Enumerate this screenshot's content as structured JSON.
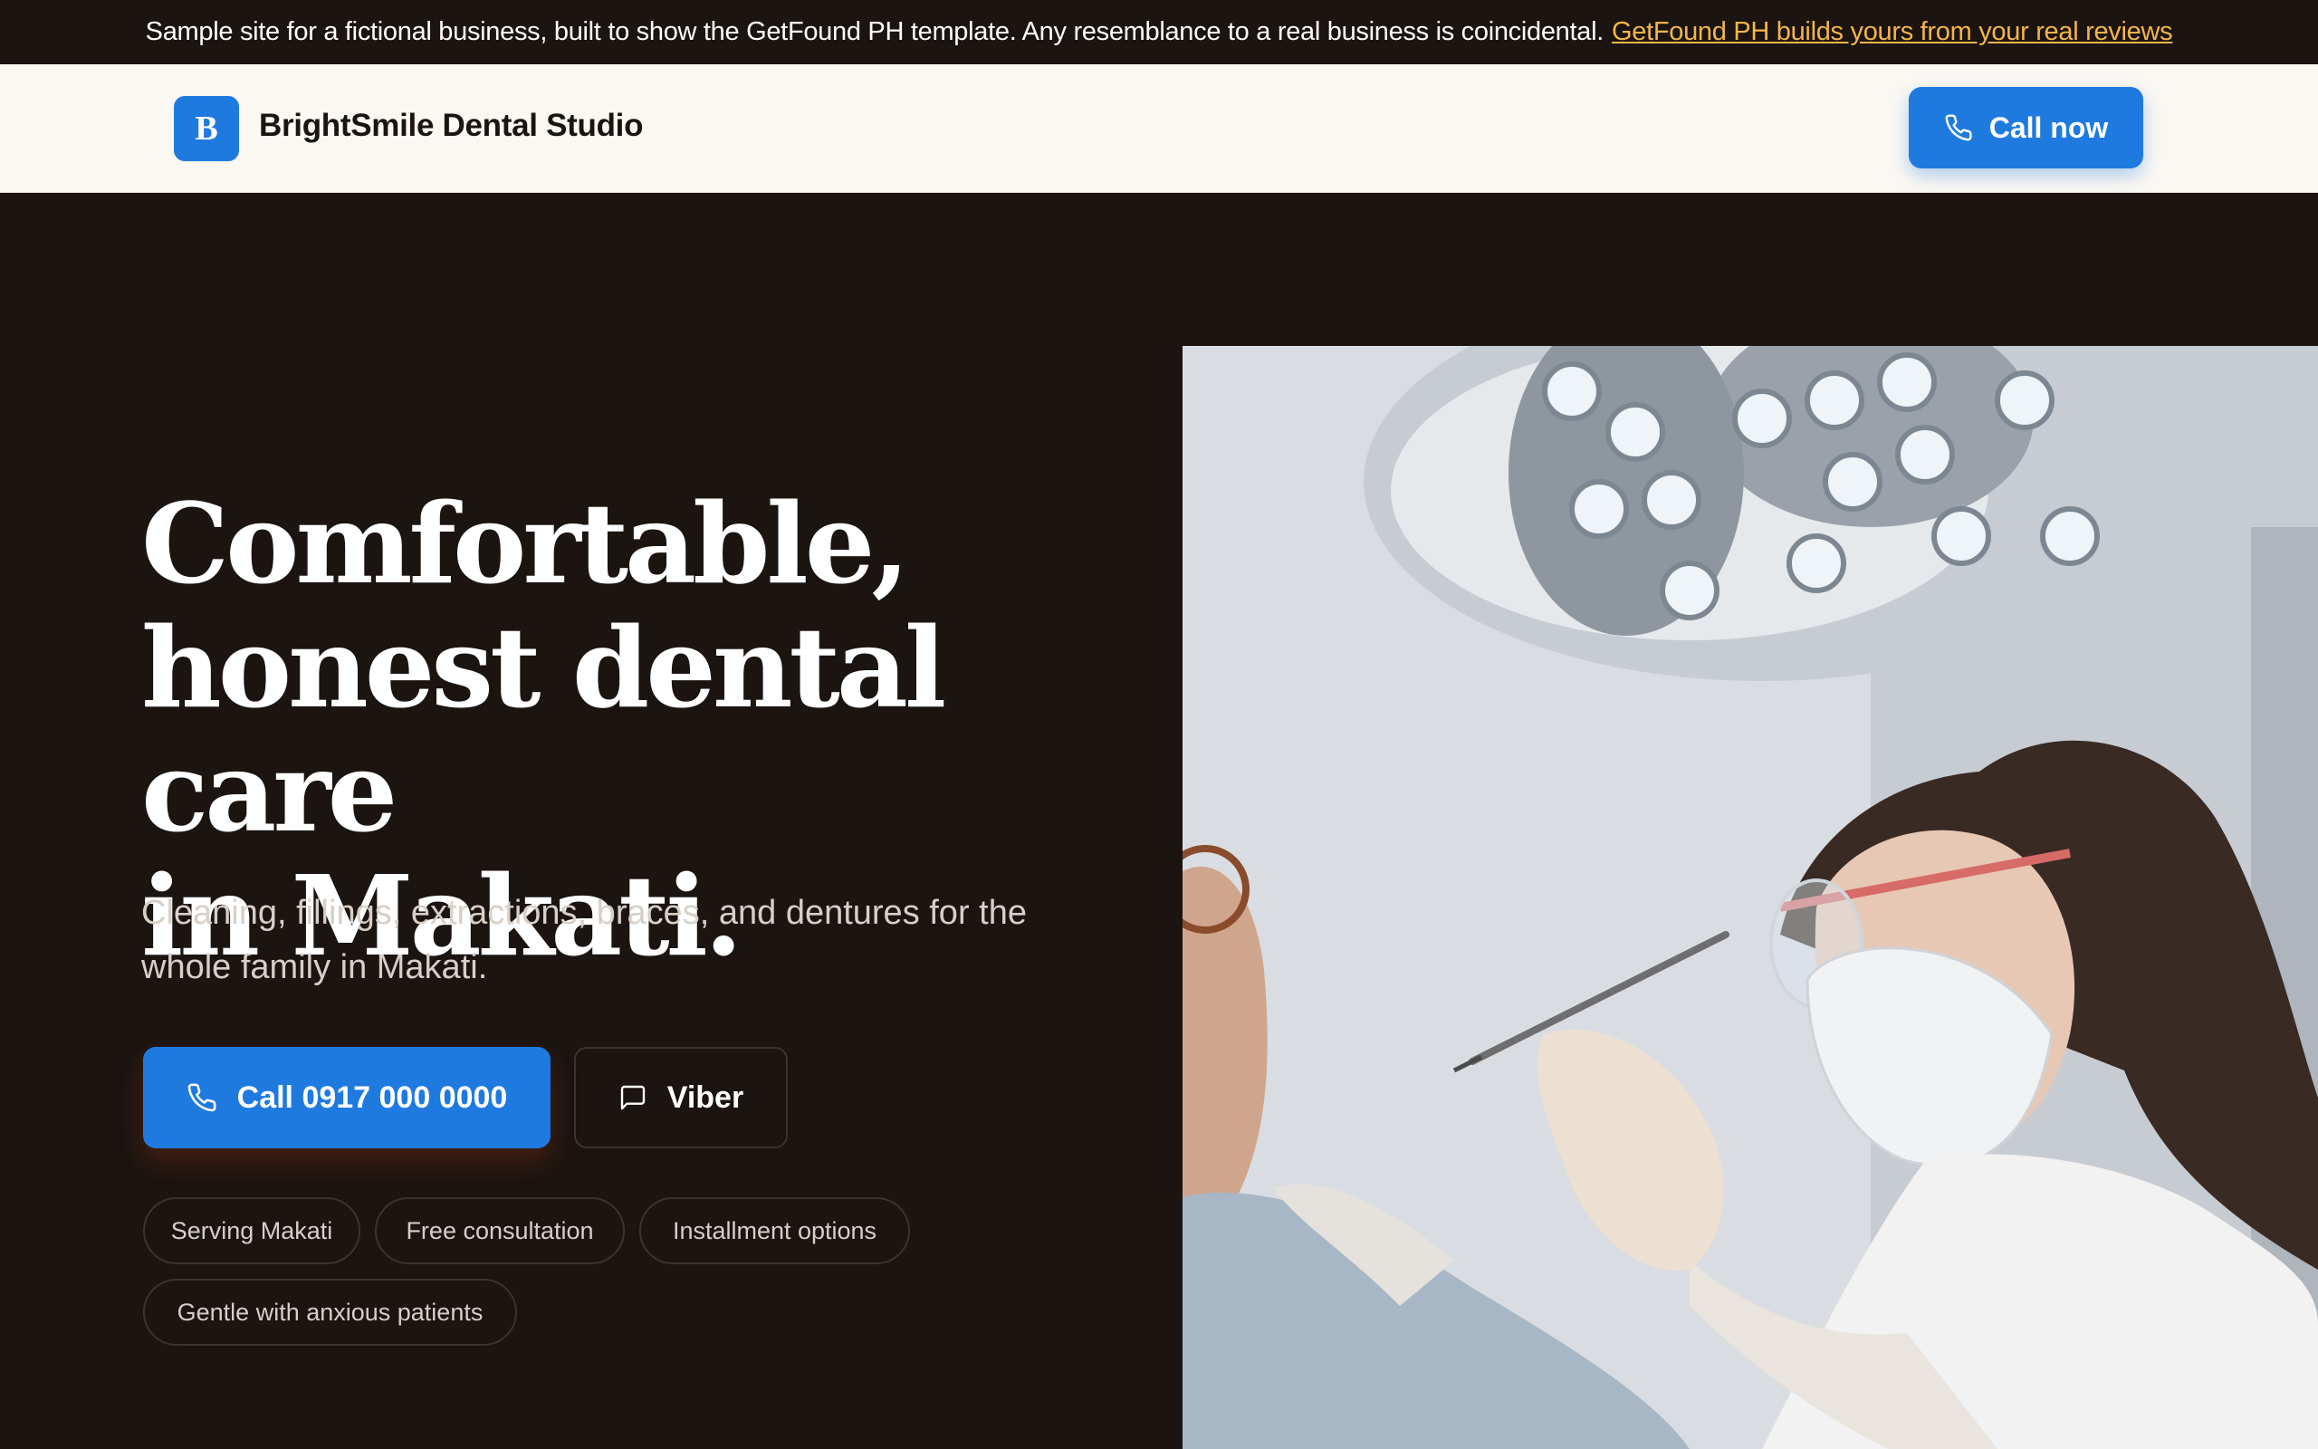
{
  "banner": {
    "text": "Sample site for a fictional business, built to show the GetFound PH template. Any resemblance to a real business is coincidental.",
    "link": "GetFound PH builds yours from your real reviews"
  },
  "header": {
    "logo_letter": "B",
    "brand": "BrightSmile Dental Studio",
    "call_now": "Call now"
  },
  "hero": {
    "title_lines": [
      "Comfortable,",
      "honest dental care",
      "in Makati."
    ],
    "subtitle": "Cleaning, fillings, extractions, braces, and dentures for the whole family in Makati.",
    "call_button": "Call 0917 000 0000",
    "viber_button": "Viber",
    "chips": [
      "Serving Makati",
      "Free consultation",
      "Installment options",
      "Gentle with anxious patients"
    ]
  },
  "colors": {
    "accent": "#1f7ae0",
    "dark_bg": "#1b1411",
    "header_bg": "#fbf8f3",
    "link": "#f3b64a"
  },
  "icons": {
    "phone": "phone-icon",
    "chat": "chat-bubble-icon"
  }
}
